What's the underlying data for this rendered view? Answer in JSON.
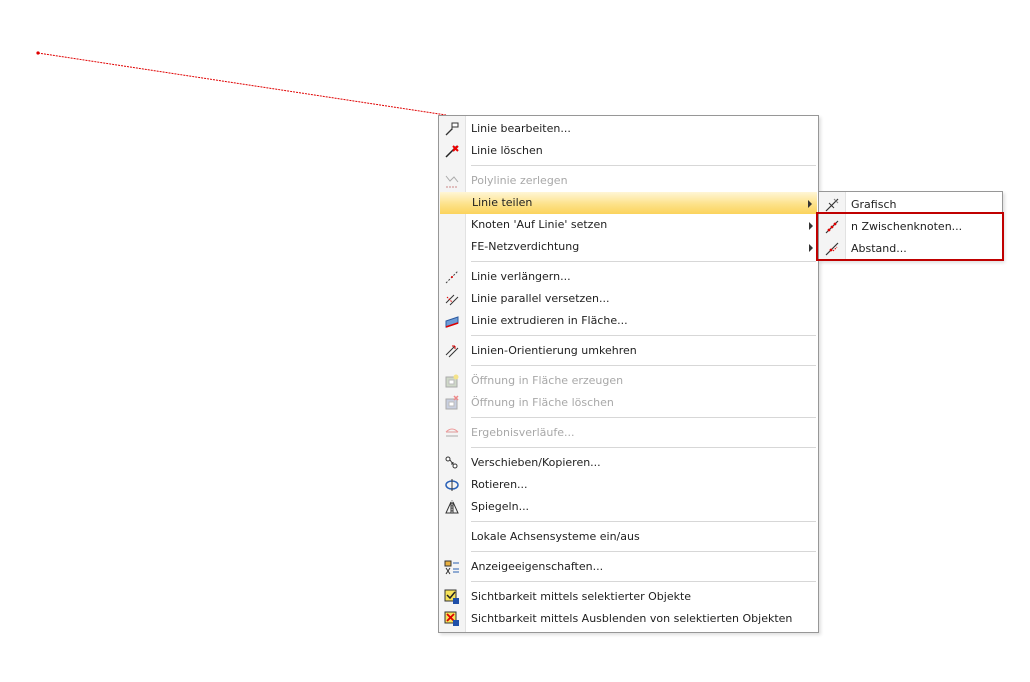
{
  "colors": {
    "line": "#e00000",
    "highlight_frame": "#c00000",
    "menu_hover": "#fde28a"
  },
  "main_menu": [
    {
      "type": "item",
      "label": "Linie bearbeiten...",
      "icon": "edit-line-icon"
    },
    {
      "type": "item",
      "label": "Linie löschen",
      "icon": "delete-line-icon"
    },
    {
      "type": "sep"
    },
    {
      "type": "item",
      "label": "Polylinie zerlegen",
      "icon": "polyline-icon",
      "disabled": true
    },
    {
      "type": "item",
      "label": "Linie teilen",
      "icon": "",
      "submenu": true,
      "highlighted": true
    },
    {
      "type": "item",
      "label": "Knoten 'Auf Linie' setzen",
      "icon": "",
      "submenu": true
    },
    {
      "type": "item",
      "label": "FE-Netzverdichtung",
      "icon": "",
      "submenu": true
    },
    {
      "type": "sep"
    },
    {
      "type": "item",
      "label": "Linie verlängern...",
      "icon": "extend-line-icon"
    },
    {
      "type": "item",
      "label": "Linie parallel versetzen...",
      "icon": "offset-line-icon"
    },
    {
      "type": "item",
      "label": "Linie extrudieren in Fläche...",
      "icon": "extrude-icon"
    },
    {
      "type": "sep"
    },
    {
      "type": "item",
      "label": "Linien-Orientierung umkehren",
      "icon": "reverse-orientation-icon"
    },
    {
      "type": "sep"
    },
    {
      "type": "item",
      "label": "Öffnung in Fläche erzeugen",
      "icon": "create-opening-icon",
      "disabled": true
    },
    {
      "type": "item",
      "label": "Öffnung in Fläche löschen",
      "icon": "delete-opening-icon",
      "disabled": true
    },
    {
      "type": "sep"
    },
    {
      "type": "item",
      "label": "Ergebnisverläufe...",
      "icon": "result-diagram-icon",
      "disabled": true
    },
    {
      "type": "sep"
    },
    {
      "type": "item",
      "label": "Verschieben/Kopieren...",
      "icon": "move-copy-icon"
    },
    {
      "type": "item",
      "label": "Rotieren...",
      "icon": "rotate-icon"
    },
    {
      "type": "item",
      "label": "Spiegeln...",
      "icon": "mirror-icon"
    },
    {
      "type": "sep"
    },
    {
      "type": "item",
      "label": "Lokale Achsensysteme ein/aus",
      "icon": ""
    },
    {
      "type": "sep"
    },
    {
      "type": "item",
      "label": "Anzeigeeigenschaften...",
      "icon": "display-properties-icon"
    },
    {
      "type": "sep"
    },
    {
      "type": "item",
      "label": "Sichtbarkeit mittels selektierter Objekte",
      "icon": "visibility-selected-icon"
    },
    {
      "type": "item",
      "label": "Sichtbarkeit mittels Ausblenden von selektierten Objekten",
      "icon": "visibility-hide-icon"
    }
  ],
  "sub_menu": [
    {
      "label": "Grafisch",
      "icon": "divide-graphic-icon"
    },
    {
      "label": "n Zwischenknoten...",
      "icon": "divide-n-nodes-icon"
    },
    {
      "label": "Abstand...",
      "icon": "divide-distance-icon"
    }
  ]
}
